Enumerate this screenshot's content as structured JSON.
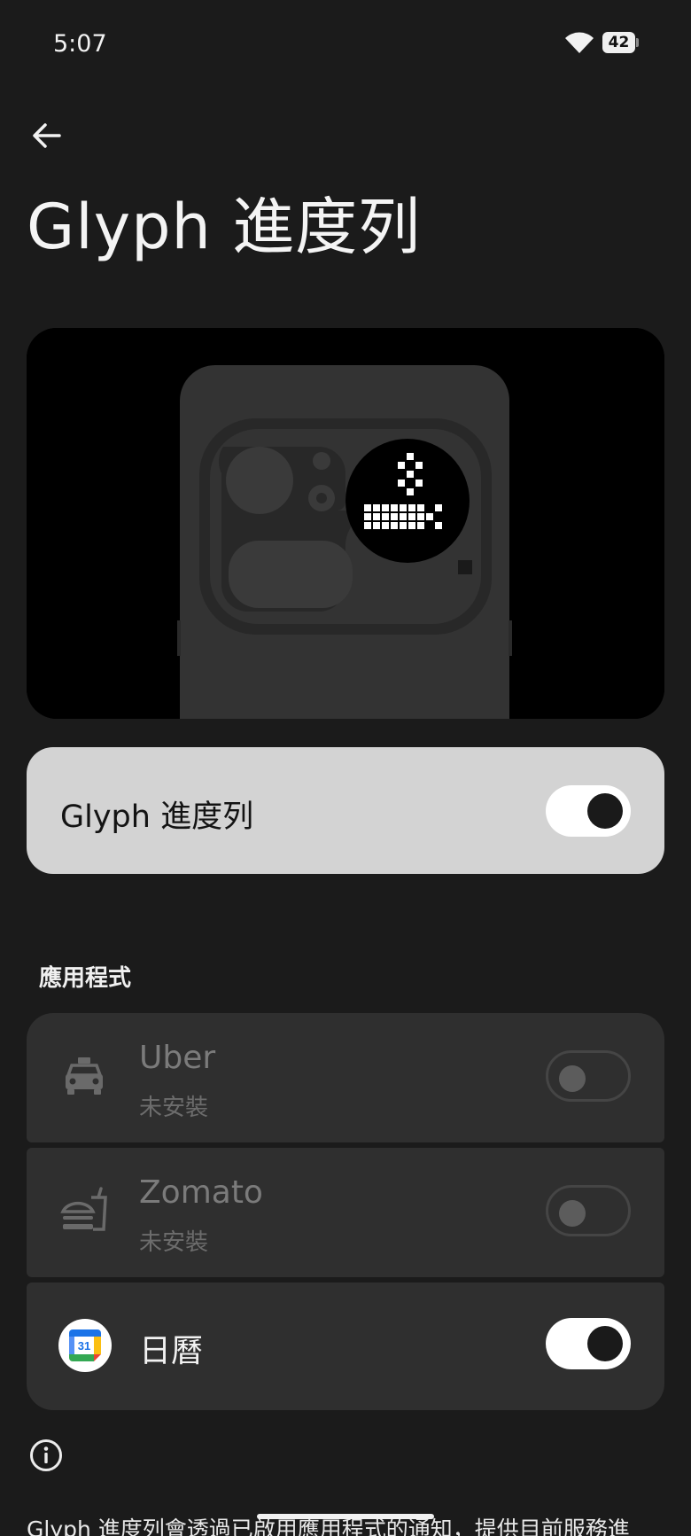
{
  "status_bar": {
    "time": "5:07",
    "battery_level": "42",
    "wifi_icon": "wifi-icon",
    "battery_icon": "battery-icon"
  },
  "header": {
    "back_icon": "back-arrow-icon",
    "title": "Glyph 進度列"
  },
  "preview": {
    "image_name": "phone-glyph-illustration"
  },
  "master_toggle": {
    "label": "Glyph 進度列",
    "enabled": true
  },
  "apps_section": {
    "label": "應用程式",
    "items": [
      {
        "name": "Uber",
        "subtitle": "未安裝",
        "icon": "taxi-icon",
        "enabled": false,
        "installed": false
      },
      {
        "name": "Zomato",
        "subtitle": "未安裝",
        "icon": "food-icon",
        "enabled": false,
        "installed": false
      },
      {
        "name": "日曆",
        "icon": "google-calendar-icon",
        "calendar_number": "31",
        "enabled": true,
        "installed": true
      }
    ]
  },
  "info": {
    "icon": "info-icon",
    "text": "Glyph 進度列會透過已啟用應用程式的通知，提供目前服務進"
  },
  "colors": {
    "background": "#1b1b1b",
    "card": "#2f2f2f",
    "master_card": "#d3d3d3",
    "toggle_on": "#ffffff",
    "toggle_knob_on": "#1a1a1a"
  }
}
